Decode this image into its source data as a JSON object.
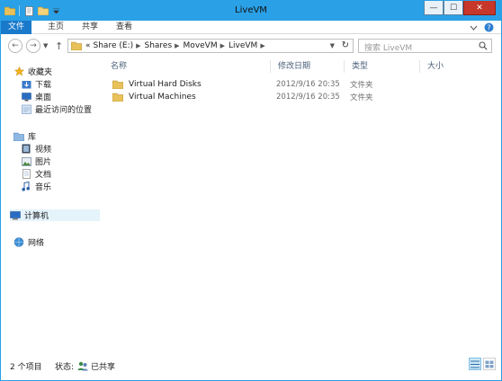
{
  "window": {
    "title": "LiveVM",
    "controls": {
      "minimize": "—",
      "maximize": "☐",
      "close": "✕"
    }
  },
  "ribbon": {
    "tabs": [
      "文件",
      "主页",
      "共享",
      "查看"
    ],
    "help_icon": "help-icon"
  },
  "navigation": {
    "back_icon": "back-arrow-icon",
    "forward_icon": "forward-arrow-icon",
    "up_icon": "up-arrow-icon",
    "breadcrumb_prefix": "«",
    "breadcrumbs": [
      "Share (E:)",
      "Shares",
      "MoveVM",
      "LiveVM"
    ],
    "search_placeholder": "搜索 LiveVM"
  },
  "sidebar": {
    "items": [
      {
        "label": "收藏夹",
        "icon": "star-icon"
      },
      {
        "label": "下载",
        "icon": "download-folder-icon"
      },
      {
        "label": "桌面",
        "icon": "desktop-icon"
      },
      {
        "label": "最近访问的位置",
        "icon": "recent-places-icon"
      },
      {
        "label": "库",
        "icon": "library-icon"
      },
      {
        "label": "视频",
        "icon": "video-icon"
      },
      {
        "label": "图片",
        "icon": "picture-icon"
      },
      {
        "label": "文档",
        "icon": "document-icon"
      },
      {
        "label": "音乐",
        "icon": "music-icon"
      },
      {
        "label": "计算机",
        "icon": "computer-icon"
      },
      {
        "label": "网络",
        "icon": "network-icon"
      }
    ]
  },
  "table": {
    "columns": [
      "名称",
      "修改日期",
      "类型",
      "大小"
    ],
    "rows": [
      {
        "name": "Virtual Hard Disks",
        "modified": "2012/9/16 20:35",
        "type": "文件夹",
        "size": ""
      },
      {
        "name": "Virtual Machines",
        "modified": "2012/9/16 20:35",
        "type": "文件夹",
        "size": ""
      }
    ]
  },
  "status": {
    "item_count": "2 个项目",
    "state_label": "状态:",
    "state_value": "已共享"
  },
  "colors": {
    "titlebar": "#2aa0e6",
    "file_tab": "#1979ca",
    "folder": "#e8c15a",
    "close_button": "#c7382a"
  }
}
